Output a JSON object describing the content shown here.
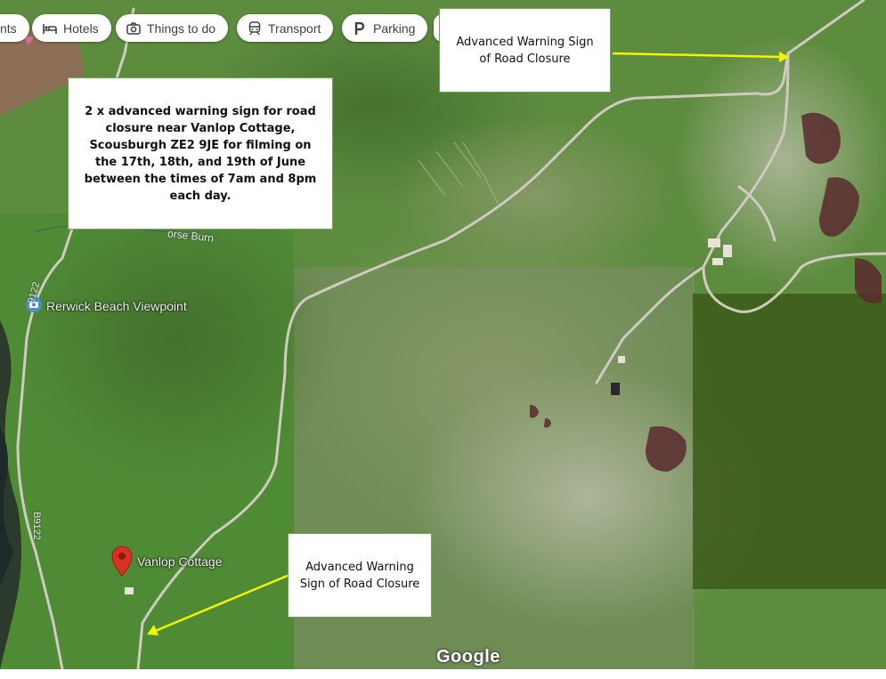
{
  "toolbar": {
    "chips": [
      {
        "label": "nts",
        "icon": "map-marker-icon"
      },
      {
        "label": "Hotels",
        "icon": "bed-icon"
      },
      {
        "label": "Things to do",
        "icon": "camera-icon"
      },
      {
        "label": "Transport",
        "icon": "train-icon"
      },
      {
        "label": "Parking",
        "icon": "parking-icon"
      },
      {
        "label": "",
        "icon": "more-icon"
      }
    ]
  },
  "notes": {
    "main": "2 x advanced warning sign for road closure near Vanlop Cottage, Scousburgh ZE2 9JE for filming on the 17th, 18th, and 19th of June between the times of 7am and 8pm each day.",
    "sign_top": "Advanced Warning Sign of Road Closure",
    "sign_bottom": "Advanced Warning Sign of Road Closure"
  },
  "places": {
    "viewpoint": "Rerwick Beach Viewpoint",
    "cottage": "Vanlop Cottage"
  },
  "map_labels": {
    "burn": "orse Burn",
    "road_b9122_lower": "B9122",
    "road_b9122_upper": "9122"
  },
  "branding": "Google",
  "colors": {
    "arrow": "#f4f400",
    "note_border": "#6aa84f",
    "pin": "#d93025",
    "road": "#c9c6bd"
  }
}
